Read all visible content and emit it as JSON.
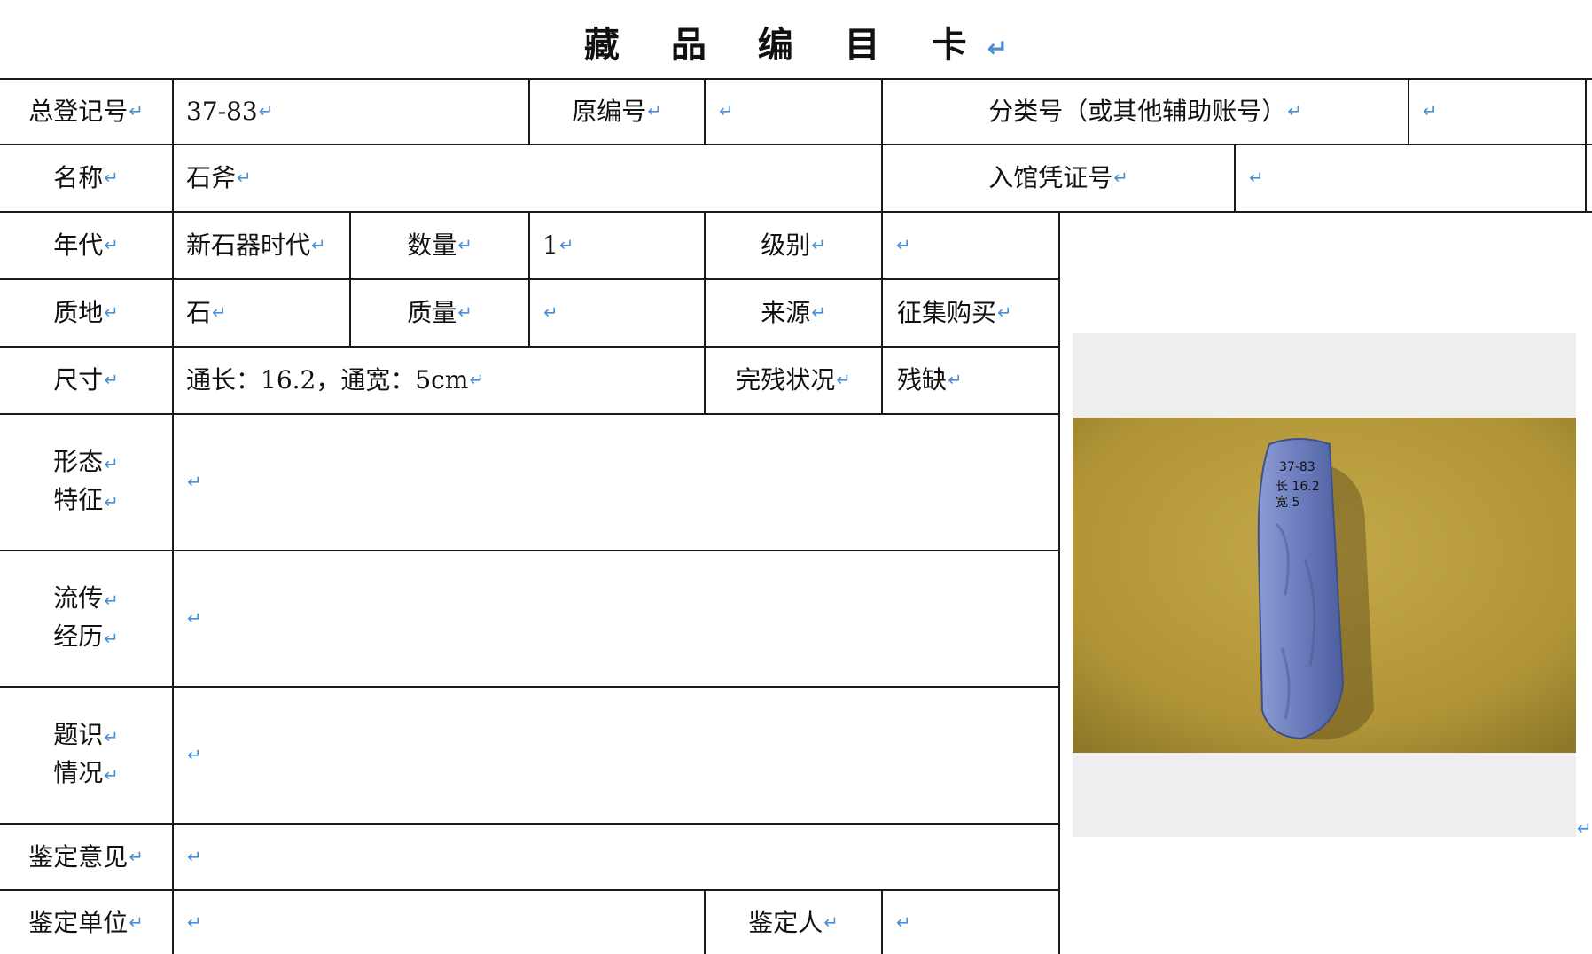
{
  "title": "藏 品 编 目 卡",
  "paragraph_mark": "↵",
  "rows": {
    "reg_no": {
      "label": "总登记号",
      "value": "37-83"
    },
    "orig_no": {
      "label": "原编号",
      "value": ""
    },
    "class_no": {
      "label": "分类号（或其他辅助账号）",
      "value": ""
    },
    "name": {
      "label": "名称",
      "value": "石斧"
    },
    "voucher": {
      "label": "入馆凭证号",
      "value": ""
    },
    "era": {
      "label": "年代",
      "value": "新石器时代"
    },
    "quantity": {
      "label": "数量",
      "value": "1"
    },
    "grade": {
      "label": "级别",
      "value": ""
    },
    "material": {
      "label": "质地",
      "value": "石"
    },
    "weight": {
      "label": "质量",
      "value": ""
    },
    "source": {
      "label": "来源",
      "value": "征集购买"
    },
    "size": {
      "label": "尺寸",
      "value": "通长：16.2，通宽：5cm"
    },
    "condition": {
      "label": "完残状况",
      "value": "残缺"
    },
    "form": {
      "label_1": "形态",
      "label_2": "特征",
      "value": ""
    },
    "history": {
      "label_1": "流传",
      "label_2": "经历",
      "value": ""
    },
    "inscription": {
      "label_1": "题识",
      "label_2": "情况",
      "value": ""
    },
    "opinion": {
      "label": "鉴定意见",
      "value": ""
    },
    "unit": {
      "label": "鉴定单位",
      "value": ""
    },
    "appraiser": {
      "label": "鉴定人",
      "value": ""
    }
  },
  "photo": {
    "handwritten_lines": [
      "37-83",
      "长 16.2",
      "宽 5"
    ],
    "colors": {
      "background": "#b49a3e",
      "stone": "#6d7fbf"
    }
  }
}
